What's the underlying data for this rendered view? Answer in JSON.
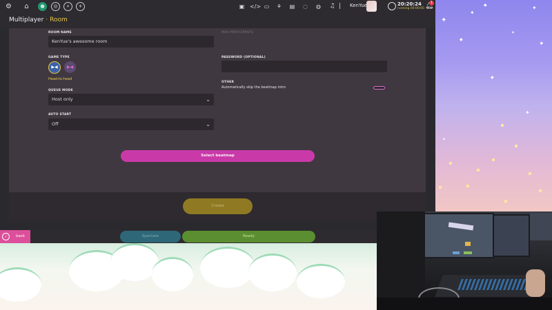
{
  "topbar": {
    "username": "KenYue",
    "time": "20:20:24",
    "runtime": "running 00:00:05",
    "notification_count": "1",
    "nav_icons": [
      "settings-icon",
      "home-icon",
      "play-icon",
      "globe-icon",
      "next-icon",
      "plus-icon"
    ],
    "tool_icons": [
      "chat-icon",
      "code-icon",
      "book-icon",
      "network-icon",
      "news-icon",
      "world-icon",
      "music-icon"
    ]
  },
  "header": {
    "title": "Multiplayer",
    "separator": "·",
    "subtitle": "Room"
  },
  "form": {
    "room_name_label": "ROOM NAME",
    "room_name_value": "KenYue's awesome room",
    "max_participants_label": "MAX PARTICIPANTS",
    "game_type_label": "GAME TYPE",
    "game_type_selected": "Head-to-head",
    "password_label": "PASSWORD (OPTIONAL)",
    "password_value": "",
    "other_label": "OTHER",
    "auto_skip_text": "Automatically skip the beatmap intro",
    "auto_skip_enabled": false,
    "queue_mode_label": "QUEUE MODE",
    "queue_mode_value": "Host only",
    "auto_start_label": "AUTO START",
    "auto_start_value": "Off"
  },
  "buttons": {
    "select_beatmap": "Select beatmap",
    "create": "Create",
    "back": "back",
    "spectate": "Spectate",
    "ready": "Ready"
  },
  "colors": {
    "accent_yellow": "#e8c84a",
    "select_beatmap": "#c93aa8",
    "create": "#8f7a23",
    "spectate": "#2e6878",
    "ready": "#5b8e30",
    "back": "#dc4f9b",
    "active_tab": "#1f9a6e"
  }
}
